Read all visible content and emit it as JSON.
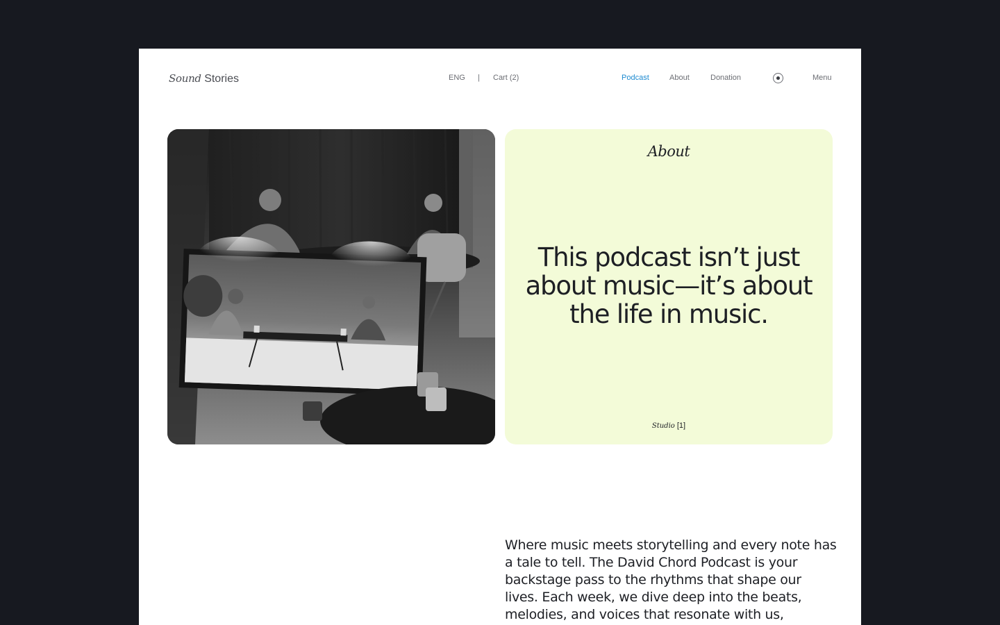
{
  "header": {
    "logo_italic": "Sound",
    "logo_plain": "Stories",
    "language": "ENG",
    "separator": "|",
    "cart": "Cart (2)",
    "nav": [
      "Podcast",
      "About",
      "Donation"
    ],
    "active_nav": "Podcast",
    "record_icon": "record-icon",
    "menu": "Menu"
  },
  "colors": {
    "background": "#171920",
    "page": "#ffffff",
    "accent": "#1d8ad0",
    "card": "#f3fbd8",
    "text": "#1d1f24"
  },
  "hero": {
    "image_alt": "Black and white podcast studio with two hosts at a table and a monitor showing the scene",
    "card_title": "About",
    "quote": "This podcast isn’t just about music—it’s about the life in music.",
    "footer_italic": "Studio",
    "footer_count": "[1]"
  },
  "intro": {
    "text": "Where music meets storytelling and every note has a tale to tell. The David Chord Podcast is your backstage pass to the rhythms that shape our lives. Each week, we dive deep into the beats, melodies, and voices that resonate with us,"
  }
}
